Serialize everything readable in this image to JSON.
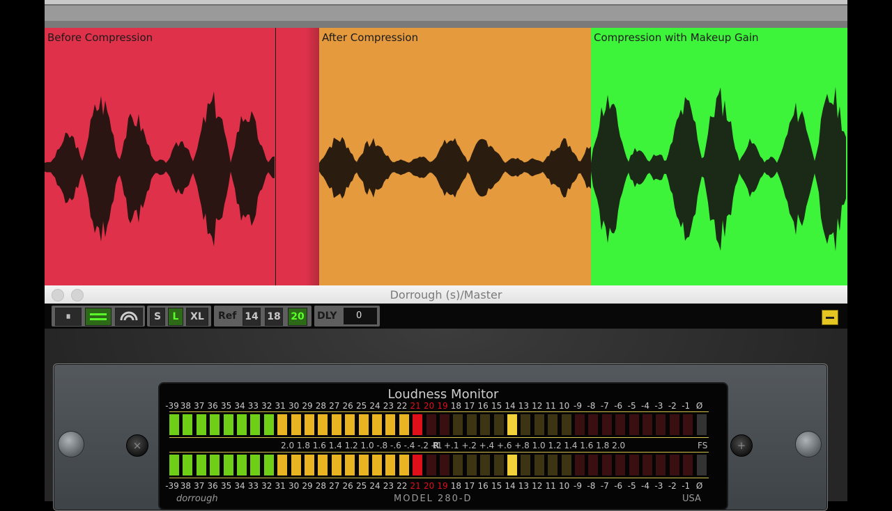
{
  "clips": [
    {
      "label": "Before Compression",
      "color": "#e0314a",
      "dark": "#b92a3c"
    },
    {
      "label": "After Compression",
      "color": "#e59a3e",
      "dark": "#b97428"
    },
    {
      "label": "Compression with Makeup Gain",
      "color": "#3ef43b",
      "dark": "#2eb92c"
    }
  ],
  "window": {
    "title": "Dorrough (s)/Master"
  },
  "toolbar": {
    "pause": "⏸",
    "bars": "bars-icon",
    "arc": "arc-icon",
    "s": "S",
    "l": "L",
    "xl": "XL",
    "ref": "Ref",
    "r14": "14",
    "r18": "18",
    "r20": "20",
    "dly": "DLY",
    "dly_value": "0"
  },
  "meter": {
    "title": "Loudness Monitor",
    "scale": [
      "-39",
      "38",
      "37",
      "36",
      "35",
      "34",
      "33",
      "32",
      "31",
      "30",
      "29",
      "28",
      "27",
      "26",
      "25",
      "24",
      "23",
      "22",
      "21",
      "20",
      "19",
      "18",
      "17",
      "16",
      "15",
      "14",
      "13",
      "12",
      "11",
      "10",
      "-9",
      "-8",
      "-7",
      "-6",
      "-5",
      "-4",
      "-3",
      "-2",
      "-1",
      "Ø"
    ],
    "mid_left": "2.0 1.8 1.6 1.4 1.2 1.0 -.8 -.6 -.4 -.2 -.1",
    "mid_center": "R",
    "mid_right": "+.1 +.2 +.4 +.6 +.8 1.0 1.2 1.4 1.6 1.8 2.0",
    "fs": "FS",
    "brand": "dorrough",
    "model": "MODEL 280-D",
    "country": "USA"
  },
  "colors": {
    "green": "#6fcf17",
    "amber": "#e9b422",
    "red": "#e0101a",
    "dim_amber": "#3d3414",
    "dim_red": "#3a0f12",
    "peak": "#f2d23a"
  }
}
